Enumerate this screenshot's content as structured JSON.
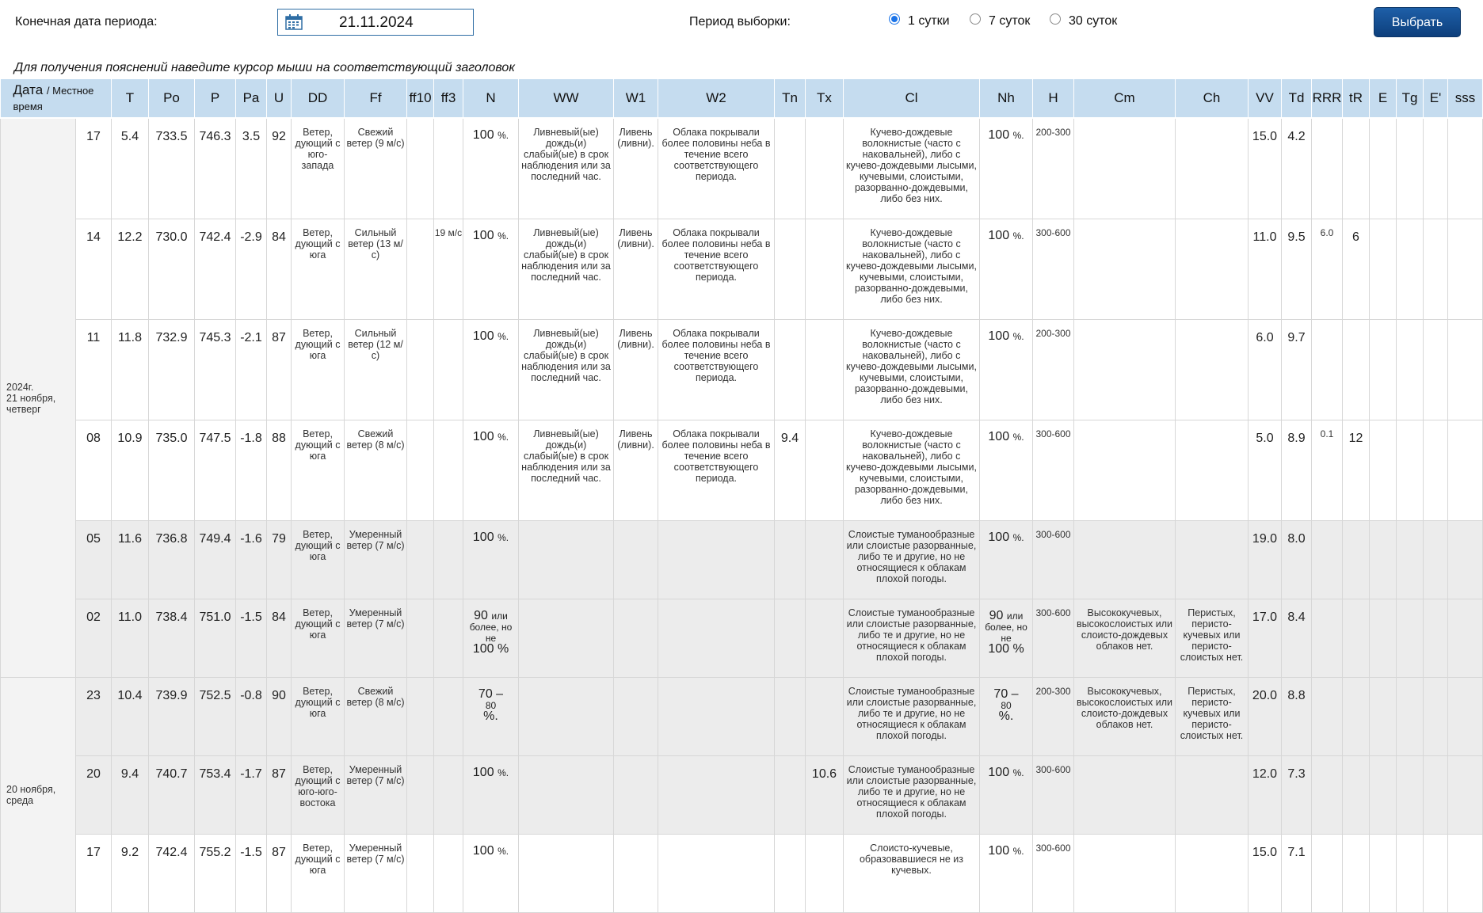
{
  "form": {
    "end_date_label": "Конечная дата периода:",
    "end_date_value": "21.11.2024",
    "period_label": "Период выборки:",
    "radio_options": [
      "1 сутки",
      "7 суток",
      "30 суток"
    ],
    "selected_option": "1 сутки",
    "submit_label": "Выбрать",
    "hint": "Для получения пояснений наведите курсор мыши на соответствующий заголовок"
  },
  "colors": {
    "header_bg": "#c5dcef",
    "button_bg": "#1e5fa8",
    "night_row_bg": "#ececec"
  },
  "table": {
    "header": {
      "date": "Дата",
      "local_time": "/ Местное время",
      "columns": [
        "T",
        "Po",
        "P",
        "Pa",
        "U",
        "DD",
        "Ff",
        "ff10",
        "ff3",
        "N",
        "WW",
        "W1",
        "W2",
        "Tn",
        "Tx",
        "Cl",
        "Nh",
        "H",
        "Cm",
        "Ch",
        "VV",
        "Td",
        "RRR",
        "tR",
        "E",
        "Tg",
        "E'",
        "sss"
      ]
    },
    "days": [
      {
        "year": "2024г.",
        "day": "21 ноября,",
        "weekday": "четверг"
      },
      {
        "year": "",
        "day": "20 ноября,",
        "weekday": "среда"
      }
    ],
    "rows": [
      {
        "time": "17",
        "T": "5.4",
        "Po": "733.5",
        "P": "746.3",
        "Pa": "3.5",
        "U": "92",
        "DD": "Ветер, дующий с юго-запада",
        "Ff": "Свежий ветер (9 м/с)",
        "ff10": "",
        "ff3": "",
        "N_val": "100",
        "N_unit": "%.",
        "N_more": "",
        "N_max": "",
        "WW": "Ливневый(ые) дождь(и) слабый(ые) в срок наблюдения или за последний час.",
        "W1": "Ливень (ливни).",
        "W2": "Облака покрывали более половины неба в течение всего соответствующего периода.",
        "Tn": "",
        "Tx": "",
        "Cl": "Кучево-дождевые волокнистые (часто с наковальней), либо с кучево-дождевыми лысыми, кучевыми, слоистыми, разорванно-дождевыми, либо без них.",
        "Nh_val": "100",
        "Nh_unit": "%.",
        "Nh_more": "",
        "Nh_max": "",
        "H": "200-300",
        "Cm": "",
        "Ch": "",
        "VV": "15.0",
        "Td": "4.2",
        "RRR": "",
        "tR": ""
      },
      {
        "time": "14",
        "T": "12.2",
        "Po": "730.0",
        "P": "742.4",
        "Pa": "-2.9",
        "U": "84",
        "DD": "Ветер, дующий с юга",
        "Ff": "Сильный ветер (13 м/с)",
        "ff10": "",
        "ff3": "19 м/с",
        "N_val": "100",
        "N_unit": "%.",
        "N_more": "",
        "N_max": "",
        "WW": "Ливневый(ые) дождь(и) слабый(ые) в срок наблюдения или за последний час.",
        "W1": "Ливень (ливни).",
        "W2": "Облака покрывали более половины неба в течение всего соответствующего периода.",
        "Tn": "",
        "Tx": "",
        "Cl": "Кучево-дождевые волокнистые (часто с наковальней), либо с кучево-дождевыми лысыми, кучевыми, слоистыми, разорванно-дождевыми, либо без них.",
        "Nh_val": "100",
        "Nh_unit": "%.",
        "Nh_more": "",
        "Nh_max": "",
        "H": "300-600",
        "Cm": "",
        "Ch": "",
        "VV": "11.0",
        "Td": "9.5",
        "RRR": "6.0",
        "tR": "6"
      },
      {
        "time": "11",
        "T": "11.8",
        "Po": "732.9",
        "P": "745.3",
        "Pa": "-2.1",
        "U": "87",
        "DD": "Ветер, дующий с юга",
        "Ff": "Сильный ветер (12 м/с)",
        "ff10": "",
        "ff3": "",
        "N_val": "100",
        "N_unit": "%.",
        "N_more": "",
        "N_max": "",
        "WW": "Ливневый(ые) дождь(и) слабый(ые) в срок наблюдения или за последний час.",
        "W1": "Ливень (ливни).",
        "W2": "Облака покрывали более половины неба в течение всего соответствующего периода.",
        "Tn": "",
        "Tx": "",
        "Cl": "Кучево-дождевые волокнистые (часто с наковальней), либо с кучево-дождевыми лысыми, кучевыми, слоистыми, разорванно-дождевыми, либо без них.",
        "Nh_val": "100",
        "Nh_unit": "%.",
        "Nh_more": "",
        "Nh_max": "",
        "H": "200-300",
        "Cm": "",
        "Ch": "",
        "VV": "6.0",
        "Td": "9.7",
        "RRR": "",
        "tR": ""
      },
      {
        "time": "08",
        "T": "10.9",
        "Po": "735.0",
        "P": "747.5",
        "Pa": "-1.8",
        "U": "88",
        "DD": "Ветер, дующий с юга",
        "Ff": "Свежий ветер (8 м/с)",
        "ff10": "",
        "ff3": "",
        "N_val": "100",
        "N_unit": "%.",
        "N_more": "",
        "N_max": "",
        "WW": "Ливневый(ые) дождь(и) слабый(ые) в срок наблюдения или за последний час.",
        "W1": "Ливень (ливни).",
        "W2": "Облака покрывали более половины неба в течение всего соответствующего периода.",
        "Tn": "9.4",
        "Tx": "",
        "Cl": "Кучево-дождевые волокнистые (часто с наковальней), либо с кучево-дождевыми лысыми, кучевыми, слоистыми, разорванно-дождевыми, либо без них.",
        "Nh_val": "100",
        "Nh_unit": "%.",
        "Nh_more": "",
        "Nh_max": "",
        "H": "300-600",
        "Cm": "",
        "Ch": "",
        "VV": "5.0",
        "Td": "8.9",
        "RRR": "0.1",
        "tR": "12"
      },
      {
        "time": "05",
        "T": "11.6",
        "Po": "736.8",
        "P": "749.4",
        "Pa": "-1.6",
        "U": "79",
        "DD": "Ветер, дующий с юга",
        "Ff": "Умеренный ветер (7 м/с)",
        "ff10": "",
        "ff3": "",
        "N_val": "100",
        "N_unit": "%.",
        "N_more": "",
        "N_max": "",
        "WW": "",
        "W1": "",
        "W2": "",
        "Tn": "",
        "Tx": "",
        "Cl": "Слоистые туманообразные или слоистые разорванные, либо те и другие, но не относящиеся к облакам плохой погоды.",
        "Nh_val": "100",
        "Nh_unit": "%.",
        "Nh_more": "",
        "Nh_max": "",
        "H": "300-600",
        "Cm": "",
        "Ch": "",
        "VV": "19.0",
        "Td": "8.0",
        "RRR": "",
        "tR": ""
      },
      {
        "time": "02",
        "T": "11.0",
        "Po": "738.4",
        "P": "751.0",
        "Pa": "-1.5",
        "U": "84",
        "DD": "Ветер, дующий с юга",
        "Ff": "Умеренный ветер (7 м/с)",
        "ff10": "",
        "ff3": "",
        "N_val": "90",
        "N_unit": "или",
        "N_more": "более, но не",
        "N_max": "100 %",
        "WW": "",
        "W1": "",
        "W2": "",
        "Tn": "",
        "Tx": "",
        "Cl": "Слоистые туманообразные или слоистые разорванные, либо те и другие, но не относящиеся к облакам плохой погоды.",
        "Nh_val": "90",
        "Nh_unit": "или",
        "Nh_more": "более, но не",
        "Nh_max": "100 %",
        "H": "300-600",
        "Cm": "Высококучевых, высокослоистых или слоисто-дождевых облаков нет.",
        "Ch": "Перистых, перисто-кучевых или перисто-слоистых нет.",
        "VV": "17.0",
        "Td": "8.4",
        "RRR": "",
        "tR": ""
      },
      {
        "time": "23",
        "T": "10.4",
        "Po": "739.9",
        "P": "752.5",
        "Pa": "-0.8",
        "U": "90",
        "DD": "Ветер, дующий с юга",
        "Ff": "Свежий ветер (8 м/с)",
        "ff10": "",
        "ff3": "",
        "N_val": "70 –",
        "N_unit": "",
        "N_more": "80",
        "N_max": "%.",
        "WW": "",
        "W1": "",
        "W2": "",
        "Tn": "",
        "Tx": "",
        "Cl": "Слоистые туманообразные или слоистые разорванные, либо те и другие, но не относящиеся к облакам плохой погоды.",
        "Nh_val": "70 –",
        "Nh_unit": "",
        "Nh_more": "80",
        "Nh_max": "%.",
        "H": "200-300",
        "Cm": "Высококучевых, высокослоистых или слоисто-дождевых облаков нет.",
        "Ch": "Перистых, перисто-кучевых или перисто-слоистых нет.",
        "VV": "20.0",
        "Td": "8.8",
        "RRR": "",
        "tR": ""
      },
      {
        "time": "20",
        "T": "9.4",
        "Po": "740.7",
        "P": "753.4",
        "Pa": "-1.7",
        "U": "87",
        "DD": "Ветер, дующий с юго-юго-востока",
        "Ff": "Умеренный ветер (7 м/с)",
        "ff10": "",
        "ff3": "",
        "N_val": "100",
        "N_unit": "%.",
        "N_more": "",
        "N_max": "",
        "WW": "",
        "W1": "",
        "W2": "",
        "Tn": "",
        "Tx": "10.6",
        "Cl": "Слоистые туманообразные или слоистые разорванные, либо те и другие, но не относящиеся к облакам плохой погоды.",
        "Nh_val": "100",
        "Nh_unit": "%.",
        "Nh_more": "",
        "Nh_max": "",
        "H": "300-600",
        "Cm": "",
        "Ch": "",
        "VV": "12.0",
        "Td": "7.3",
        "RRR": "",
        "tR": ""
      },
      {
        "time": "17",
        "T": "9.2",
        "Po": "742.4",
        "P": "755.2",
        "Pa": "-1.5",
        "U": "87",
        "DD": "Ветер, дующий с юга",
        "Ff": "Умеренный ветер (7 м/с)",
        "ff10": "",
        "ff3": "",
        "N_val": "100",
        "N_unit": "%.",
        "N_more": "",
        "N_max": "",
        "WW": "",
        "W1": "",
        "W2": "",
        "Tn": "",
        "Tx": "",
        "Cl": "Слоисто-кучевые, образовавшиеся не из кучевых.",
        "Nh_val": "100",
        "Nh_unit": "%.",
        "Nh_more": "",
        "Nh_max": "",
        "H": "300-600",
        "Cm": "",
        "Ch": "",
        "VV": "15.0",
        "Td": "7.1",
        "RRR": "",
        "tR": ""
      }
    ]
  }
}
